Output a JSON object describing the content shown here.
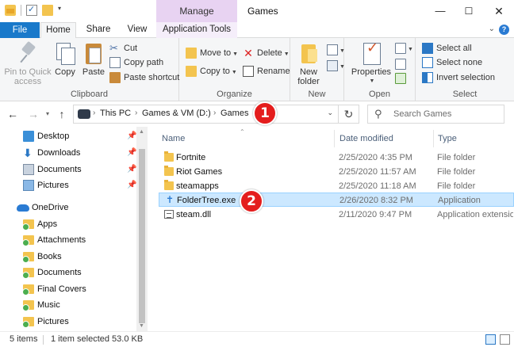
{
  "window": {
    "title": "Games",
    "context_tab": "Manage",
    "controls": {
      "minimize": "—",
      "maximize": "☐",
      "close": "✕"
    }
  },
  "ribbon_tabs": [
    "File",
    "Home",
    "Share",
    "View",
    "Application Tools"
  ],
  "ribbon": {
    "clipboard": {
      "label": "Clipboard",
      "pin": "Pin to Quick access",
      "pin_line1": "Pin to Quick",
      "pin_line2": "access",
      "copy": "Copy",
      "paste": "Paste",
      "cut": "Cut",
      "copy_path": "Copy path",
      "paste_shortcut": "Paste shortcut"
    },
    "organize": {
      "label": "Organize",
      "move_to": "Move to",
      "copy_to": "Copy to",
      "delete": "Delete",
      "rename": "Rename"
    },
    "new": {
      "label": "New",
      "new_folder_line1": "New",
      "new_folder_line2": "folder"
    },
    "open": {
      "label": "Open",
      "properties": "Properties"
    },
    "select": {
      "label": "Select",
      "select_all": "Select all",
      "select_none": "Select none",
      "invert_selection": "Invert selection"
    }
  },
  "address": {
    "crumbs": [
      "This PC",
      "Games & VM (D:)",
      "Games"
    ],
    "search_placeholder": "Search Games"
  },
  "nav_pane": {
    "quick_access": [
      {
        "label": "Desktop",
        "icon": "desktop-icon",
        "pinned": true
      },
      {
        "label": "Downloads",
        "icon": "downloads-icon",
        "pinned": true
      },
      {
        "label": "Documents",
        "icon": "documents-icon",
        "pinned": true
      },
      {
        "label": "Pictures",
        "icon": "pictures-icon",
        "pinned": true
      }
    ],
    "onedrive": {
      "label": "OneDrive",
      "items": [
        "Apps",
        "Attachments",
        "Books",
        "Documents",
        "Final Covers",
        "Music",
        "Pictures"
      ]
    }
  },
  "columns": {
    "name": "Name",
    "date": "Date modified",
    "type": "Type"
  },
  "files": [
    {
      "name": "Fortnite",
      "date": "2/25/2020 4:35 PM",
      "type": "File folder",
      "icon": "folder-icon",
      "selected": false
    },
    {
      "name": "Riot Games",
      "date": "2/25/2020 11:57 AM",
      "type": "File folder",
      "icon": "folder-icon",
      "selected": false
    },
    {
      "name": "steamapps",
      "date": "2/25/2020 11:18 AM",
      "type": "File folder",
      "icon": "folder-icon",
      "selected": false
    },
    {
      "name": "FolderTree.exe",
      "date": "2/26/2020 8:32 PM",
      "type": "Application",
      "icon": "exe-icon",
      "selected": true
    },
    {
      "name": "steam.dll",
      "date": "2/11/2020 9:47 PM",
      "type": "Application extension",
      "icon": "dll-icon",
      "selected": false
    }
  ],
  "callouts": [
    "1",
    "2"
  ],
  "status": {
    "item_count": "5 items",
    "selection": "1 item selected  53.0 KB"
  },
  "colors": {
    "accent": "#1979ca",
    "manage_tab": "#e8d3f2",
    "selection_bg": "#cce8ff",
    "callout": "#e41d1d"
  }
}
